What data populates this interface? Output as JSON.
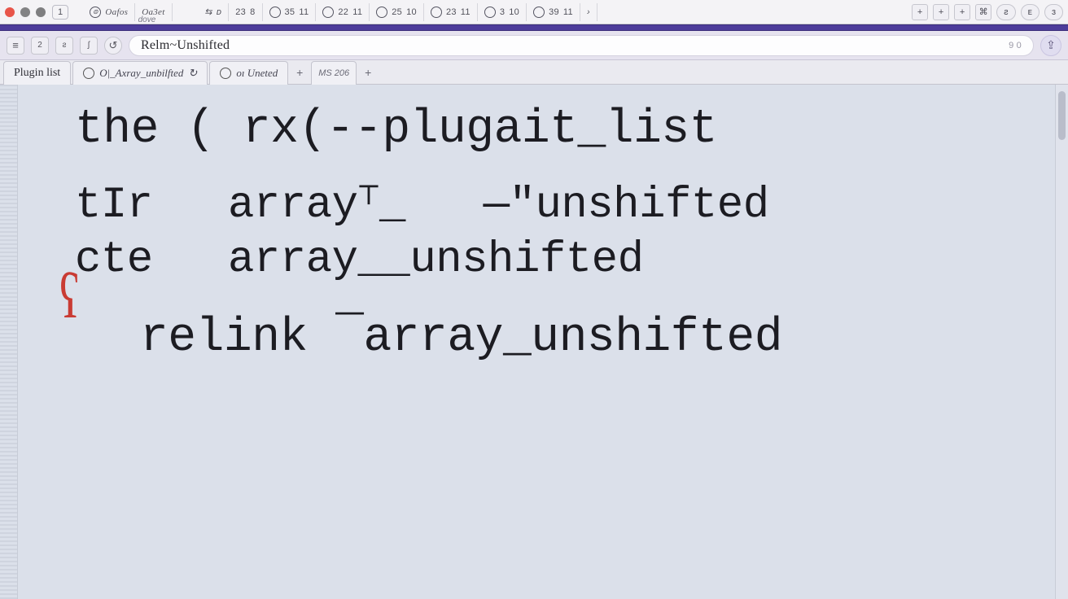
{
  "titlebar": {
    "dove_label": "dove",
    "tab_first": "1",
    "tabs": [
      {
        "labelA": "Oafos",
        "labelB": ""
      },
      {
        "labelA": "Oa3et",
        "labelB": ""
      },
      {
        "labelA": "23",
        "labelB": "8"
      },
      {
        "labelA": "35",
        "labelB": "11"
      },
      {
        "labelA": "22",
        "labelB": "11"
      },
      {
        "labelA": "25",
        "labelB": "10"
      },
      {
        "labelA": "23",
        "labelB": "11"
      },
      {
        "labelA": "3",
        "labelB": "10"
      },
      {
        "labelA": "39",
        "labelB": "11"
      }
    ],
    "tail_btns": [
      "+",
      "+",
      "+"
    ],
    "tail_glyph": "⌘",
    "tail_pills": [
      "ƨ",
      "ᴇ",
      "ɜ"
    ]
  },
  "addr": {
    "ctls_left": [
      "≡",
      "2",
      "ƨ",
      "ʃ",
      "↺"
    ],
    "omni_text": "Relm~Unshifted",
    "omni_tail": "9 0",
    "right_glyph": "⇪"
  },
  "doctabs": {
    "main": "Plugin list",
    "inner1": "O|_Axray_unbilfted",
    "inner2": "oı Uneted",
    "mini": "MS 206"
  },
  "code": {
    "line1": "the ( rx(--plugait_list",
    "col1a": "tIr",
    "col1b": "cte",
    "col2a": "array⸆_   —\"unshifted",
    "col2b": "array__unshifted",
    "line4": "relink ¯array_unshifted",
    "redmark": "ʕ"
  }
}
